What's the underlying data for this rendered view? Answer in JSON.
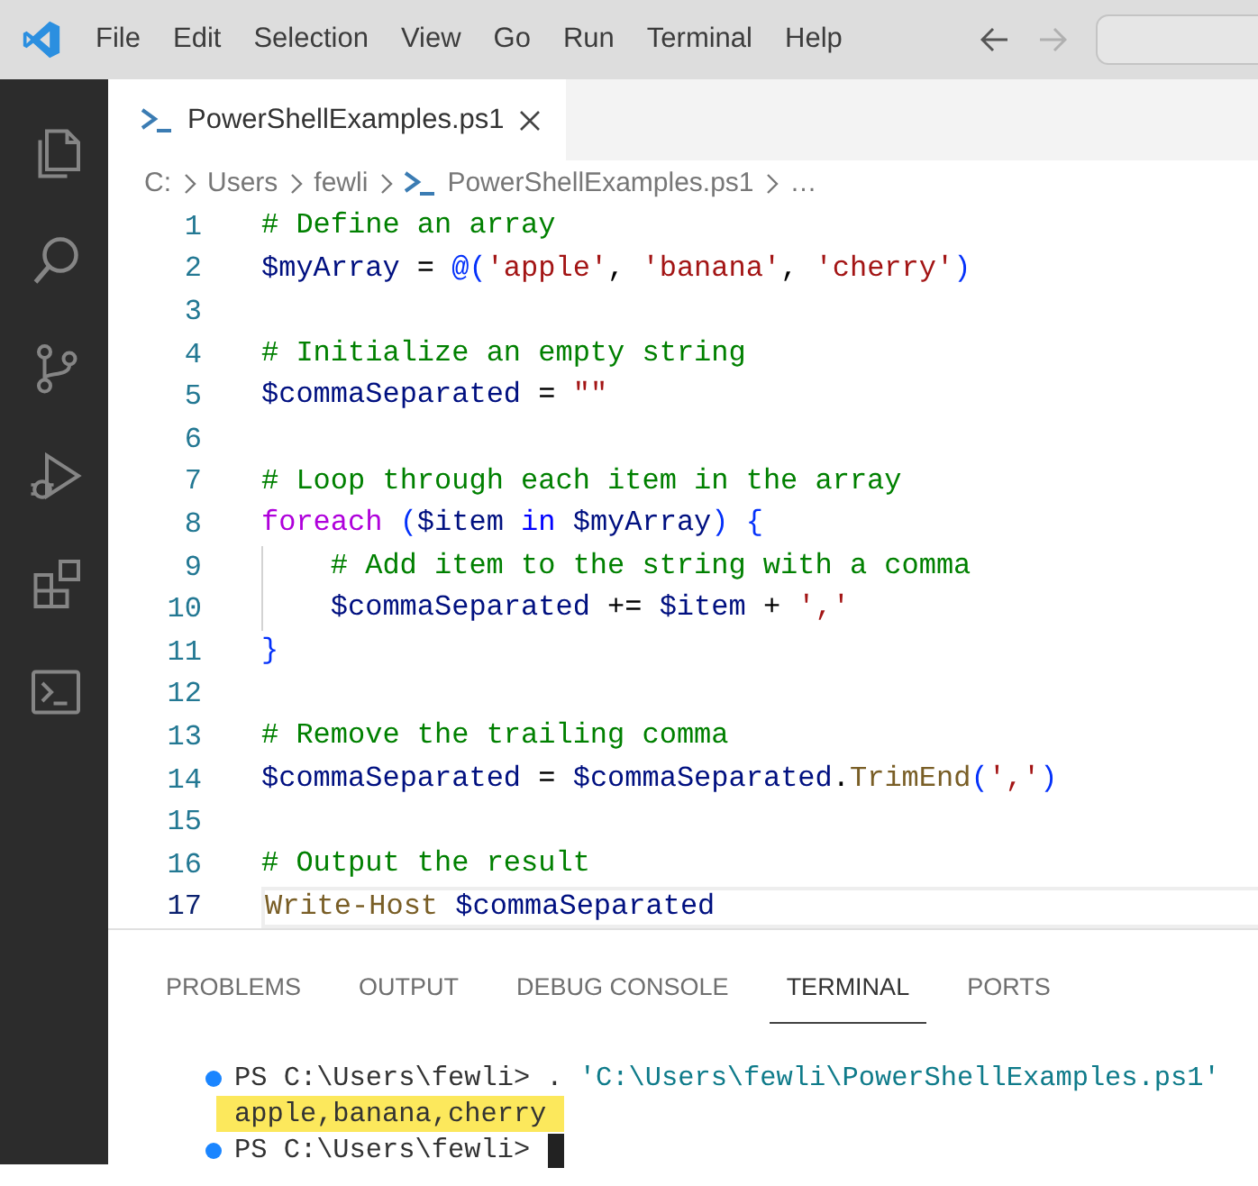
{
  "menu": [
    "File",
    "Edit",
    "Selection",
    "View",
    "Go",
    "Run",
    "Terminal",
    "Help"
  ],
  "activity_bar": [
    {
      "kind": "explorer",
      "selected": false
    },
    {
      "kind": "search",
      "selected": false
    },
    {
      "kind": "source-control",
      "selected": false
    },
    {
      "kind": "run-debug",
      "selected": false
    },
    {
      "kind": "extensions",
      "selected": false
    },
    {
      "kind": "terminal",
      "selected": false
    }
  ],
  "editor_tabs": [
    {
      "label": "PowerShellExamples.ps1",
      "selected": true
    }
  ],
  "breadcrumbs": [
    {
      "label": "C:",
      "kind": "folder"
    },
    {
      "label": "Users",
      "kind": "folder"
    },
    {
      "label": "fewli",
      "kind": "folder"
    },
    {
      "label": "PowerShellExamples.ps1",
      "kind": "file"
    },
    {
      "label": "…",
      "kind": "symbol"
    }
  ],
  "code_lines": [
    {
      "number": "1",
      "indented": false,
      "current": false,
      "tokens": [
        {
          "text": "# Define an array",
          "kind": "comment"
        }
      ]
    },
    {
      "number": "2",
      "indented": false,
      "current": false,
      "tokens": [
        {
          "text": "$myArray",
          "kind": "variable"
        },
        {
          "text": " = ",
          "kind": "operator"
        },
        {
          "text": "@(",
          "kind": "bracket"
        },
        {
          "text": "'apple'",
          "kind": "string"
        },
        {
          "text": ", ",
          "kind": "operator"
        },
        {
          "text": "'banana'",
          "kind": "string"
        },
        {
          "text": ", ",
          "kind": "operator"
        },
        {
          "text": "'cherry'",
          "kind": "string"
        },
        {
          "text": ")",
          "kind": "bracket"
        }
      ]
    },
    {
      "number": "3",
      "indented": false,
      "current": false
    },
    {
      "number": "4",
      "indented": false,
      "current": false,
      "tokens": [
        {
          "text": "# Initialize an empty string",
          "kind": "comment"
        }
      ]
    },
    {
      "number": "5",
      "indented": false,
      "current": false,
      "tokens": [
        {
          "text": "$commaSeparated",
          "kind": "variable"
        },
        {
          "text": " = ",
          "kind": "operator"
        },
        {
          "text": "\"\"",
          "kind": "string"
        }
      ]
    },
    {
      "number": "6",
      "indented": false,
      "current": false
    },
    {
      "number": "7",
      "indented": false,
      "current": false,
      "tokens": [
        {
          "text": "# Loop through each item in the array",
          "kind": "comment"
        }
      ]
    },
    {
      "number": "8",
      "indented": false,
      "current": false,
      "tokens": [
        {
          "text": "foreach",
          "kind": "keyword"
        },
        {
          "text": " (",
          "kind": "bracket"
        },
        {
          "text": "$item",
          "kind": "variable"
        },
        {
          "text": " in ",
          "kind": "operator-keyword"
        },
        {
          "text": "$myArray",
          "kind": "variable"
        },
        {
          "text": ")",
          "kind": "bracket"
        },
        {
          "text": " {",
          "kind": "bracket"
        }
      ]
    },
    {
      "number": "9",
      "indented": true,
      "current": false,
      "tokens": [
        {
          "text": "# Add item to the string with a comma",
          "kind": "comment"
        }
      ]
    },
    {
      "number": "10",
      "indented": true,
      "current": false,
      "tokens": [
        {
          "text": "$commaSeparated",
          "kind": "variable"
        },
        {
          "text": " += ",
          "kind": "operator"
        },
        {
          "text": "$item",
          "kind": "variable"
        },
        {
          "text": " + ",
          "kind": "operator"
        },
        {
          "text": "','",
          "kind": "string"
        }
      ]
    },
    {
      "number": "11",
      "indented": false,
      "current": false,
      "tokens": [
        {
          "text": "}",
          "kind": "bracket"
        }
      ]
    },
    {
      "number": "12",
      "indented": false,
      "current": false
    },
    {
      "number": "13",
      "indented": false,
      "current": false,
      "tokens": [
        {
          "text": "# Remove the trailing comma",
          "kind": "comment"
        }
      ]
    },
    {
      "number": "14",
      "indented": false,
      "current": false,
      "tokens": [
        {
          "text": "$commaSeparated",
          "kind": "variable"
        },
        {
          "text": " = ",
          "kind": "operator"
        },
        {
          "text": "$commaSeparated",
          "kind": "variable"
        },
        {
          "text": ".",
          "kind": "operator"
        },
        {
          "text": "TrimEnd",
          "kind": "function"
        },
        {
          "text": "(",
          "kind": "bracket"
        },
        {
          "text": "','",
          "kind": "string"
        },
        {
          "text": ")",
          "kind": "bracket"
        }
      ]
    },
    {
      "number": "15",
      "indented": false,
      "current": false
    },
    {
      "number": "16",
      "indented": false,
      "current": false,
      "tokens": [
        {
          "text": "# Output the result",
          "kind": "comment"
        }
      ]
    },
    {
      "number": "17",
      "indented": false,
      "current": true,
      "tokens": [
        {
          "text": "Write-Host",
          "kind": "function"
        },
        {
          "text": " $commaSeparated",
          "kind": "variable"
        }
      ]
    }
  ],
  "panel_tabs": [
    {
      "label": "PROBLEMS",
      "selected": false
    },
    {
      "label": "OUTPUT",
      "selected": false
    },
    {
      "label": "DEBUG CONSOLE",
      "selected": false
    },
    {
      "label": "TERMINAL",
      "selected": true
    },
    {
      "label": "PORTS",
      "selected": false
    }
  ],
  "terminal_lines": [
    {
      "kind": "prompt",
      "highlighted": false,
      "cursor": false,
      "tokens": [
        {
          "text": "PS C:\\Users\\fewli> . ",
          "kind": "plain"
        },
        {
          "text": "'C:\\Users\\fewli\\PowerShellExamples.ps1'",
          "kind": "string"
        }
      ]
    },
    {
      "kind": "output",
      "highlighted": true,
      "cursor": false,
      "tokens": [
        {
          "text": "apple,banana,cherry",
          "kind": "plain"
        }
      ]
    },
    {
      "kind": "prompt",
      "highlighted": false,
      "cursor": true,
      "tokens": [
        {
          "text": "PS C:\\Users\\fewli>",
          "kind": "plain"
        }
      ]
    }
  ]
}
